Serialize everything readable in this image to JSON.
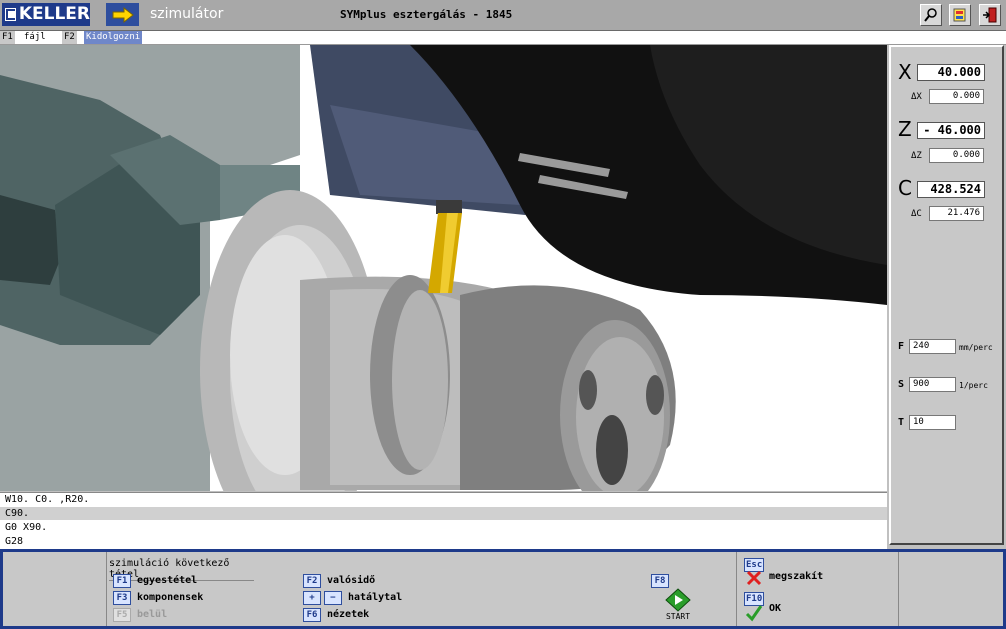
{
  "title_bar": {
    "logo_text": "KELLER",
    "app_name": "szimulátor",
    "window_title": "SYMplus esztergálás - 1845",
    "buttons": [
      "zoom-icon",
      "export-icon",
      "exit-icon"
    ]
  },
  "menu": {
    "items": [
      {
        "key": "F1",
        "label": "fájl"
      },
      {
        "key": "F2",
        "label": "Kidolgozni"
      }
    ]
  },
  "readout": {
    "x": {
      "letter": "X",
      "value": "40.000",
      "delta_label": "ΔX",
      "delta": "0.000"
    },
    "z": {
      "letter": "Z",
      "value": "-  46.000",
      "delta_label": "ΔZ",
      "delta": "0.000"
    },
    "c": {
      "letter": "C",
      "value": "428.524",
      "delta_label": "ΔC",
      "delta": "21.476"
    },
    "f": {
      "label": "F",
      "value": "240",
      "unit": "mm/perc"
    },
    "s": {
      "label": "S",
      "value": "900",
      "unit": "1/perc"
    },
    "t": {
      "label": "T",
      "value": "10"
    }
  },
  "code_lines": [
    "W10. C0. ,R20.",
    "C90.",
    "G0 X90.",
    "G28"
  ],
  "bottom": {
    "heading": "szimuláció következő tétel",
    "keys": {
      "f1": {
        "key": "F1",
        "label": "egyestétel"
      },
      "f2": {
        "key": "F2",
        "label": "valósidő"
      },
      "f3": {
        "key": "F3",
        "label": "komponensek"
      },
      "plusminus": {
        "plus": "+",
        "minus": "−",
        "label": "hatálytal"
      },
      "f5": {
        "key": "F5",
        "label": "belül"
      },
      "f6": {
        "key": "F6",
        "label": "nézetek"
      },
      "f8": {
        "key": "F8",
        "label": "START"
      },
      "esc": {
        "key": "Esc",
        "label": "megszakít"
      },
      "f10": {
        "key": "F10",
        "label": "OK"
      }
    }
  },
  "colors": {
    "brand_blue": "#1e3a8a",
    "tool_yellow": "#d4a800",
    "cancel_red": "#e02020",
    "ok_green": "#2a9d2a"
  }
}
